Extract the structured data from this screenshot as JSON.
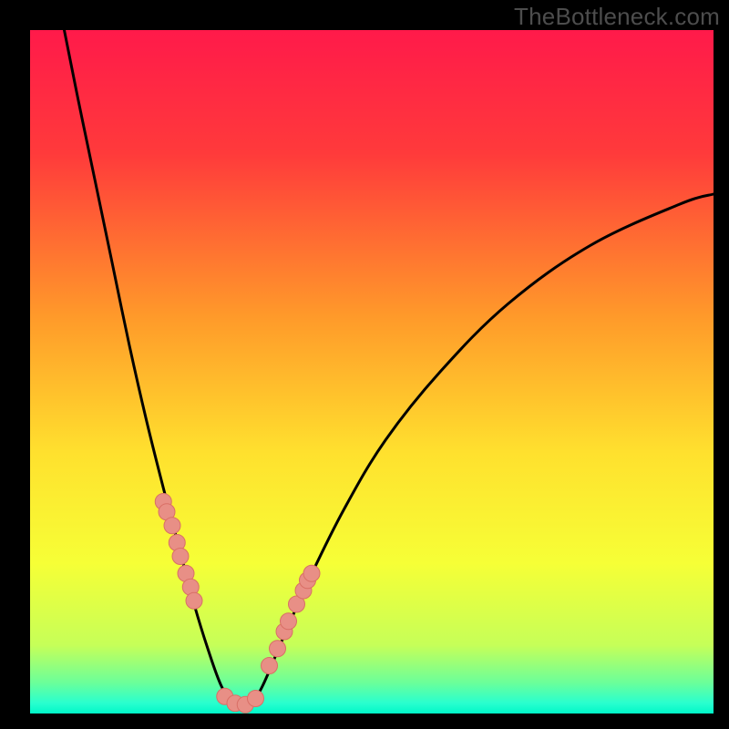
{
  "watermark": "TheBottleneck.com",
  "chart_data": {
    "type": "line",
    "title": "",
    "xlabel": "",
    "ylabel": "",
    "xlim": [
      0,
      100
    ],
    "ylim": [
      0,
      100
    ],
    "gradient_stops": [
      {
        "offset": 0.0,
        "color": "#ff1a4a"
      },
      {
        "offset": 0.18,
        "color": "#ff3a3b"
      },
      {
        "offset": 0.42,
        "color": "#ff9a2a"
      },
      {
        "offset": 0.62,
        "color": "#ffe12e"
      },
      {
        "offset": 0.78,
        "color": "#f6ff36"
      },
      {
        "offset": 0.9,
        "color": "#c6ff58"
      },
      {
        "offset": 0.955,
        "color": "#6bff9a"
      },
      {
        "offset": 0.985,
        "color": "#28ffcf"
      },
      {
        "offset": 1.0,
        "color": "#00f7c8"
      }
    ],
    "curve": [
      {
        "x": 5.0,
        "y": 100.0
      },
      {
        "x": 7.0,
        "y": 90.0
      },
      {
        "x": 9.5,
        "y": 78.0
      },
      {
        "x": 12.0,
        "y": 66.0
      },
      {
        "x": 14.5,
        "y": 54.0
      },
      {
        "x": 17.0,
        "y": 43.0
      },
      {
        "x": 19.5,
        "y": 33.0
      },
      {
        "x": 22.0,
        "y": 23.5
      },
      {
        "x": 24.0,
        "y": 16.0
      },
      {
        "x": 26.0,
        "y": 9.5
      },
      {
        "x": 28.0,
        "y": 4.0
      },
      {
        "x": 30.0,
        "y": 1.0
      },
      {
        "x": 32.0,
        "y": 1.0
      },
      {
        "x": 34.0,
        "y": 4.0
      },
      {
        "x": 37.0,
        "y": 11.0
      },
      {
        "x": 41.0,
        "y": 20.0
      },
      {
        "x": 46.0,
        "y": 30.0
      },
      {
        "x": 52.0,
        "y": 40.0
      },
      {
        "x": 60.0,
        "y": 50.0
      },
      {
        "x": 70.0,
        "y": 60.0
      },
      {
        "x": 82.0,
        "y": 68.5
      },
      {
        "x": 95.0,
        "y": 74.5
      },
      {
        "x": 100.0,
        "y": 76.0
      }
    ],
    "points_left": [
      {
        "x": 19.5,
        "y": 31.0
      },
      {
        "x": 20.0,
        "y": 29.5
      },
      {
        "x": 20.8,
        "y": 27.5
      },
      {
        "x": 21.5,
        "y": 25.0
      },
      {
        "x": 22.0,
        "y": 23.0
      },
      {
        "x": 22.8,
        "y": 20.5
      },
      {
        "x": 23.5,
        "y": 18.5
      },
      {
        "x": 24.0,
        "y": 16.5
      }
    ],
    "points_right": [
      {
        "x": 35.0,
        "y": 7.0
      },
      {
        "x": 36.2,
        "y": 9.5
      },
      {
        "x": 37.2,
        "y": 12.0
      },
      {
        "x": 37.8,
        "y": 13.5
      },
      {
        "x": 39.0,
        "y": 16.0
      },
      {
        "x": 40.0,
        "y": 18.0
      },
      {
        "x": 40.6,
        "y": 19.5
      },
      {
        "x": 41.2,
        "y": 20.5
      }
    ],
    "points_bottom": [
      {
        "x": 28.5,
        "y": 2.5
      },
      {
        "x": 30.0,
        "y": 1.5
      },
      {
        "x": 31.5,
        "y": 1.3
      },
      {
        "x": 33.0,
        "y": 2.2
      }
    ],
    "point_style": {
      "fill": "#e88f86",
      "stroke": "#d96f66",
      "radius_px": 9
    },
    "curve_style": {
      "stroke": "#000000",
      "stroke_width_px": 3
    }
  }
}
